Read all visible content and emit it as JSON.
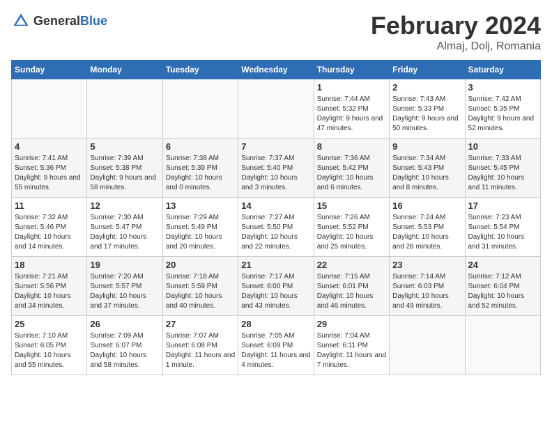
{
  "header": {
    "logo_general": "General",
    "logo_blue": "Blue",
    "title": "February 2024",
    "location": "Almaj, Dolj, Romania"
  },
  "columns": [
    "Sunday",
    "Monday",
    "Tuesday",
    "Wednesday",
    "Thursday",
    "Friday",
    "Saturday"
  ],
  "weeks": [
    [
      {
        "day": "",
        "sunrise": "",
        "sunset": "",
        "daylight": "",
        "empty": true
      },
      {
        "day": "",
        "sunrise": "",
        "sunset": "",
        "daylight": "",
        "empty": true
      },
      {
        "day": "",
        "sunrise": "",
        "sunset": "",
        "daylight": "",
        "empty": true
      },
      {
        "day": "",
        "sunrise": "",
        "sunset": "",
        "daylight": "",
        "empty": true
      },
      {
        "day": "1",
        "sunrise": "Sunrise: 7:44 AM",
        "sunset": "Sunset: 5:32 PM",
        "daylight": "Daylight: 9 hours and 47 minutes.",
        "empty": false
      },
      {
        "day": "2",
        "sunrise": "Sunrise: 7:43 AM",
        "sunset": "Sunset: 5:33 PM",
        "daylight": "Daylight: 9 hours and 50 minutes.",
        "empty": false
      },
      {
        "day": "3",
        "sunrise": "Sunrise: 7:42 AM",
        "sunset": "Sunset: 5:35 PM",
        "daylight": "Daylight: 9 hours and 52 minutes.",
        "empty": false
      }
    ],
    [
      {
        "day": "4",
        "sunrise": "Sunrise: 7:41 AM",
        "sunset": "Sunset: 5:36 PM",
        "daylight": "Daylight: 9 hours and 55 minutes.",
        "empty": false
      },
      {
        "day": "5",
        "sunrise": "Sunrise: 7:39 AM",
        "sunset": "Sunset: 5:38 PM",
        "daylight": "Daylight: 9 hours and 58 minutes.",
        "empty": false
      },
      {
        "day": "6",
        "sunrise": "Sunrise: 7:38 AM",
        "sunset": "Sunset: 5:39 PM",
        "daylight": "Daylight: 10 hours and 0 minutes.",
        "empty": false
      },
      {
        "day": "7",
        "sunrise": "Sunrise: 7:37 AM",
        "sunset": "Sunset: 5:40 PM",
        "daylight": "Daylight: 10 hours and 3 minutes.",
        "empty": false
      },
      {
        "day": "8",
        "sunrise": "Sunrise: 7:36 AM",
        "sunset": "Sunset: 5:42 PM",
        "daylight": "Daylight: 10 hours and 6 minutes.",
        "empty": false
      },
      {
        "day": "9",
        "sunrise": "Sunrise: 7:34 AM",
        "sunset": "Sunset: 5:43 PM",
        "daylight": "Daylight: 10 hours and 8 minutes.",
        "empty": false
      },
      {
        "day": "10",
        "sunrise": "Sunrise: 7:33 AM",
        "sunset": "Sunset: 5:45 PM",
        "daylight": "Daylight: 10 hours and 11 minutes.",
        "empty": false
      }
    ],
    [
      {
        "day": "11",
        "sunrise": "Sunrise: 7:32 AM",
        "sunset": "Sunset: 5:46 PM",
        "daylight": "Daylight: 10 hours and 14 minutes.",
        "empty": false
      },
      {
        "day": "12",
        "sunrise": "Sunrise: 7:30 AM",
        "sunset": "Sunset: 5:47 PM",
        "daylight": "Daylight: 10 hours and 17 minutes.",
        "empty": false
      },
      {
        "day": "13",
        "sunrise": "Sunrise: 7:29 AM",
        "sunset": "Sunset: 5:49 PM",
        "daylight": "Daylight: 10 hours and 20 minutes.",
        "empty": false
      },
      {
        "day": "14",
        "sunrise": "Sunrise: 7:27 AM",
        "sunset": "Sunset: 5:50 PM",
        "daylight": "Daylight: 10 hours and 22 minutes.",
        "empty": false
      },
      {
        "day": "15",
        "sunrise": "Sunrise: 7:26 AM",
        "sunset": "Sunset: 5:52 PM",
        "daylight": "Daylight: 10 hours and 25 minutes.",
        "empty": false
      },
      {
        "day": "16",
        "sunrise": "Sunrise: 7:24 AM",
        "sunset": "Sunset: 5:53 PM",
        "daylight": "Daylight: 10 hours and 28 minutes.",
        "empty": false
      },
      {
        "day": "17",
        "sunrise": "Sunrise: 7:23 AM",
        "sunset": "Sunset: 5:54 PM",
        "daylight": "Daylight: 10 hours and 31 minutes.",
        "empty": false
      }
    ],
    [
      {
        "day": "18",
        "sunrise": "Sunrise: 7:21 AM",
        "sunset": "Sunset: 5:56 PM",
        "daylight": "Daylight: 10 hours and 34 minutes.",
        "empty": false
      },
      {
        "day": "19",
        "sunrise": "Sunrise: 7:20 AM",
        "sunset": "Sunset: 5:57 PM",
        "daylight": "Daylight: 10 hours and 37 minutes.",
        "empty": false
      },
      {
        "day": "20",
        "sunrise": "Sunrise: 7:18 AM",
        "sunset": "Sunset: 5:59 PM",
        "daylight": "Daylight: 10 hours and 40 minutes.",
        "empty": false
      },
      {
        "day": "21",
        "sunrise": "Sunrise: 7:17 AM",
        "sunset": "Sunset: 6:00 PM",
        "daylight": "Daylight: 10 hours and 43 minutes.",
        "empty": false
      },
      {
        "day": "22",
        "sunrise": "Sunrise: 7:15 AM",
        "sunset": "Sunset: 6:01 PM",
        "daylight": "Daylight: 10 hours and 46 minutes.",
        "empty": false
      },
      {
        "day": "23",
        "sunrise": "Sunrise: 7:14 AM",
        "sunset": "Sunset: 6:03 PM",
        "daylight": "Daylight: 10 hours and 49 minutes.",
        "empty": false
      },
      {
        "day": "24",
        "sunrise": "Sunrise: 7:12 AM",
        "sunset": "Sunset: 6:04 PM",
        "daylight": "Daylight: 10 hours and 52 minutes.",
        "empty": false
      }
    ],
    [
      {
        "day": "25",
        "sunrise": "Sunrise: 7:10 AM",
        "sunset": "Sunset: 6:05 PM",
        "daylight": "Daylight: 10 hours and 55 minutes.",
        "empty": false
      },
      {
        "day": "26",
        "sunrise": "Sunrise: 7:09 AM",
        "sunset": "Sunset: 6:07 PM",
        "daylight": "Daylight: 10 hours and 58 minutes.",
        "empty": false
      },
      {
        "day": "27",
        "sunrise": "Sunrise: 7:07 AM",
        "sunset": "Sunset: 6:08 PM",
        "daylight": "Daylight: 11 hours and 1 minute.",
        "empty": false
      },
      {
        "day": "28",
        "sunrise": "Sunrise: 7:05 AM",
        "sunset": "Sunset: 6:09 PM",
        "daylight": "Daylight: 11 hours and 4 minutes.",
        "empty": false
      },
      {
        "day": "29",
        "sunrise": "Sunrise: 7:04 AM",
        "sunset": "Sunset: 6:11 PM",
        "daylight": "Daylight: 11 hours and 7 minutes.",
        "empty": false
      },
      {
        "day": "",
        "sunrise": "",
        "sunset": "",
        "daylight": "",
        "empty": true
      },
      {
        "day": "",
        "sunrise": "",
        "sunset": "",
        "daylight": "",
        "empty": true
      }
    ]
  ]
}
